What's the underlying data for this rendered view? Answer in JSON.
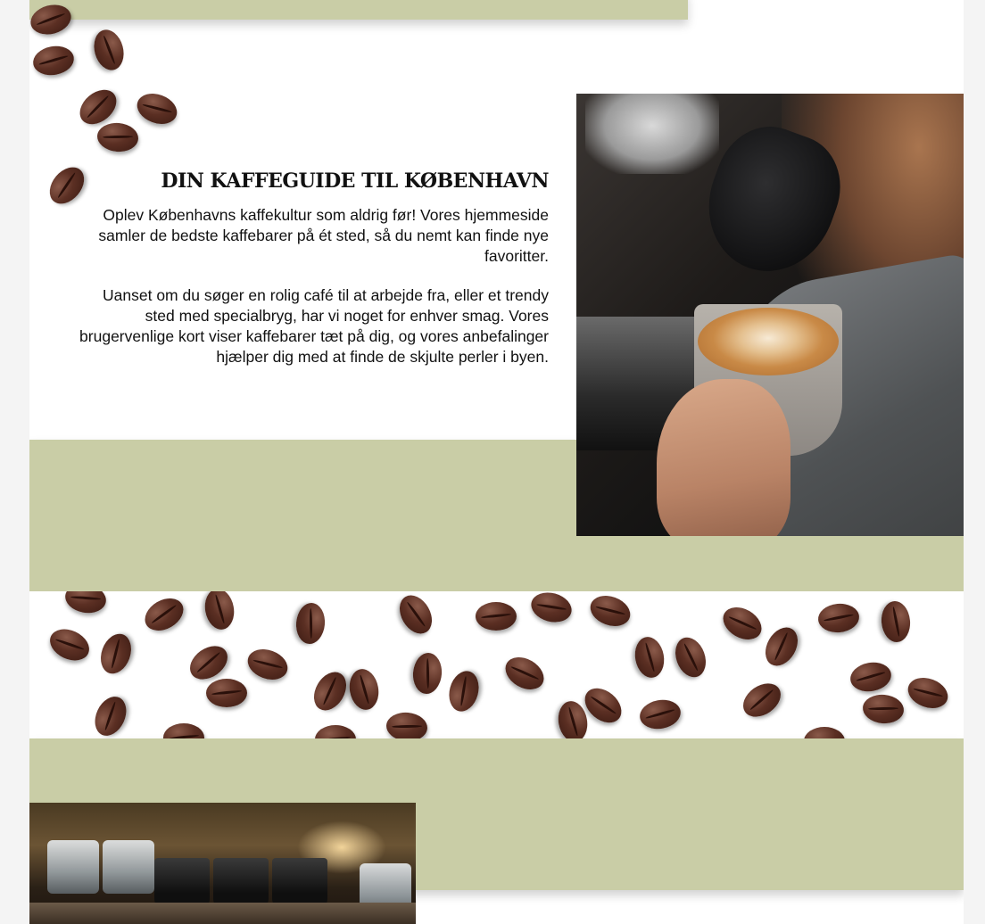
{
  "intro": {
    "heading": "DIN KAFFEGUIDE TIL KØBENHAVN",
    "paragraph_1": "Oplev Københavns kaffekultur som aldrig før! Vores hjemmeside samler de bedste kaffebarer på ét sted, så du nemt kan finde nye favoritter.",
    "paragraph_2": "Uanset om du søger en rolig café til at arbejde fra, eller et trendy sted med specialbryg, har vi noget for enhver smag. Vores brugervenlige kort viser kaffebarer tæt på dig, og vores anbefalinger hjælper dig med at finde de skjulte perler i byen."
  },
  "colors": {
    "band": "#c9cda6",
    "background": "#f4f4f4",
    "content": "#ffffff",
    "text": "#111111",
    "bean": "#5b2f23"
  },
  "images": {
    "latte_art_photo": "barista pouring latte art",
    "coffee_bar_photo": "café counter with cups",
    "decorative_beans": "coffee-bean-icon"
  }
}
